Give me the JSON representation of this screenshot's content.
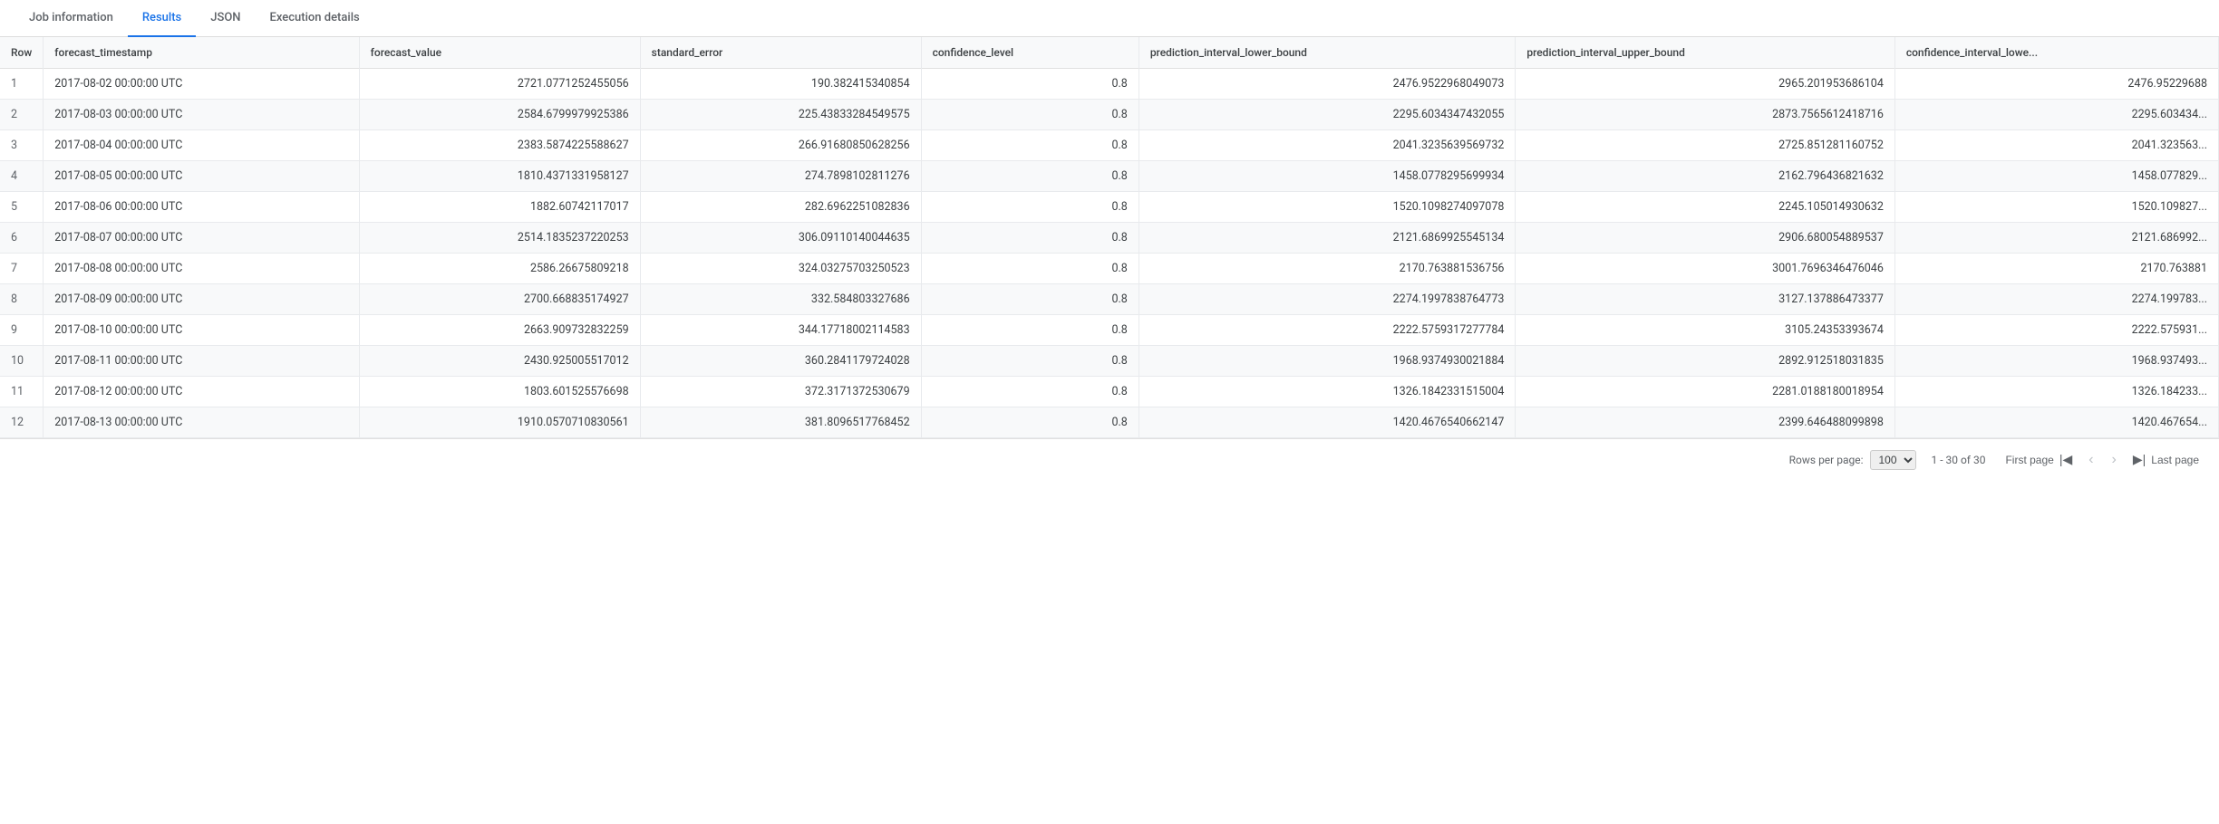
{
  "tabs": [
    {
      "id": "job-info",
      "label": "Job information",
      "active": false
    },
    {
      "id": "results",
      "label": "Results",
      "active": true
    },
    {
      "id": "json",
      "label": "JSON",
      "active": false
    },
    {
      "id": "execution",
      "label": "Execution details",
      "active": false
    }
  ],
  "table": {
    "columns": [
      {
        "id": "row",
        "label": "Row"
      },
      {
        "id": "forecast_timestamp",
        "label": "forecast_timestamp"
      },
      {
        "id": "forecast_value",
        "label": "forecast_value"
      },
      {
        "id": "standard_error",
        "label": "standard_error"
      },
      {
        "id": "confidence_level",
        "label": "confidence_level"
      },
      {
        "id": "prediction_interval_lower_bound",
        "label": "prediction_interval_lower_bound"
      },
      {
        "id": "prediction_interval_upper_bound",
        "label": "prediction_interval_upper_bound"
      },
      {
        "id": "confidence_interval_lower",
        "label": "confidence_interval_lowe..."
      }
    ],
    "rows": [
      {
        "row": "1",
        "forecast_timestamp": "2017-08-02 00:00:00 UTC",
        "forecast_value": "2721.0771252455056",
        "standard_error": "190.382415340854",
        "confidence_level": "0.8",
        "lower_bound": "2476.9522968049073",
        "upper_bound": "2965.201953686104",
        "ci_lower": "2476.95229688"
      },
      {
        "row": "2",
        "forecast_timestamp": "2017-08-03 00:00:00 UTC",
        "forecast_value": "2584.6799979925386",
        "standard_error": "225.43833284549575",
        "confidence_level": "0.8",
        "lower_bound": "2295.6034347432055",
        "upper_bound": "2873.7565612418716",
        "ci_lower": "2295.603434..."
      },
      {
        "row": "3",
        "forecast_timestamp": "2017-08-04 00:00:00 UTC",
        "forecast_value": "2383.5874225588627",
        "standard_error": "266.91680850628256",
        "confidence_level": "0.8",
        "lower_bound": "2041.3235639569732",
        "upper_bound": "2725.851281160752",
        "ci_lower": "2041.323563..."
      },
      {
        "row": "4",
        "forecast_timestamp": "2017-08-05 00:00:00 UTC",
        "forecast_value": "1810.4371331958127",
        "standard_error": "274.7898102811276",
        "confidence_level": "0.8",
        "lower_bound": "1458.0778295699934",
        "upper_bound": "2162.796436821632",
        "ci_lower": "1458.077829..."
      },
      {
        "row": "5",
        "forecast_timestamp": "2017-08-06 00:00:00 UTC",
        "forecast_value": "1882.60742117017",
        "standard_error": "282.6962251082836",
        "confidence_level": "0.8",
        "lower_bound": "1520.1098274097078",
        "upper_bound": "2245.105014930632",
        "ci_lower": "1520.109827..."
      },
      {
        "row": "6",
        "forecast_timestamp": "2017-08-07 00:00:00 UTC",
        "forecast_value": "2514.1835237220253",
        "standard_error": "306.09110140044635",
        "confidence_level": "0.8",
        "lower_bound": "2121.6869925545134",
        "upper_bound": "2906.680054889537",
        "ci_lower": "2121.686992..."
      },
      {
        "row": "7",
        "forecast_timestamp": "2017-08-08 00:00:00 UTC",
        "forecast_value": "2586.26675809218",
        "standard_error": "324.03275703250523",
        "confidence_level": "0.8",
        "lower_bound": "2170.763881536756",
        "upper_bound": "3001.7696346476046",
        "ci_lower": "2170.763881"
      },
      {
        "row": "8",
        "forecast_timestamp": "2017-08-09 00:00:00 UTC",
        "forecast_value": "2700.668835174927",
        "standard_error": "332.584803327686",
        "confidence_level": "0.8",
        "lower_bound": "2274.1997838764773",
        "upper_bound": "3127.137886473377",
        "ci_lower": "2274.199783..."
      },
      {
        "row": "9",
        "forecast_timestamp": "2017-08-10 00:00:00 UTC",
        "forecast_value": "2663.909732832259",
        "standard_error": "344.17718002114583",
        "confidence_level": "0.8",
        "lower_bound": "2222.5759317277784",
        "upper_bound": "3105.24353393674",
        "ci_lower": "2222.575931..."
      },
      {
        "row": "10",
        "forecast_timestamp": "2017-08-11 00:00:00 UTC",
        "forecast_value": "2430.925005517012",
        "standard_error": "360.2841179724028",
        "confidence_level": "0.8",
        "lower_bound": "1968.9374930021884",
        "upper_bound": "2892.912518031835",
        "ci_lower": "1968.937493..."
      },
      {
        "row": "11",
        "forecast_timestamp": "2017-08-12 00:00:00 UTC",
        "forecast_value": "1803.601525576698",
        "standard_error": "372.3171372530679",
        "confidence_level": "0.8",
        "lower_bound": "1326.1842331515004",
        "upper_bound": "2281.0188180018954",
        "ci_lower": "1326.184233..."
      },
      {
        "row": "12",
        "forecast_timestamp": "2017-08-13 00:00:00 UTC",
        "forecast_value": "1910.0570710830561",
        "standard_error": "381.8096517768452",
        "confidence_level": "0.8",
        "lower_bound": "1420.4676540662147",
        "upper_bound": "2399.646488099898",
        "ci_lower": "1420.467654..."
      }
    ]
  },
  "pagination": {
    "rows_per_page_label": "Rows per page:",
    "rows_per_page_value": "100",
    "range_label": "1 - 30 of 30",
    "first_page_label": "First page",
    "last_page_label": "Last page",
    "prev_label": "‹",
    "next_label": "›",
    "first_icon": "|‹",
    "last_icon": "›|"
  }
}
